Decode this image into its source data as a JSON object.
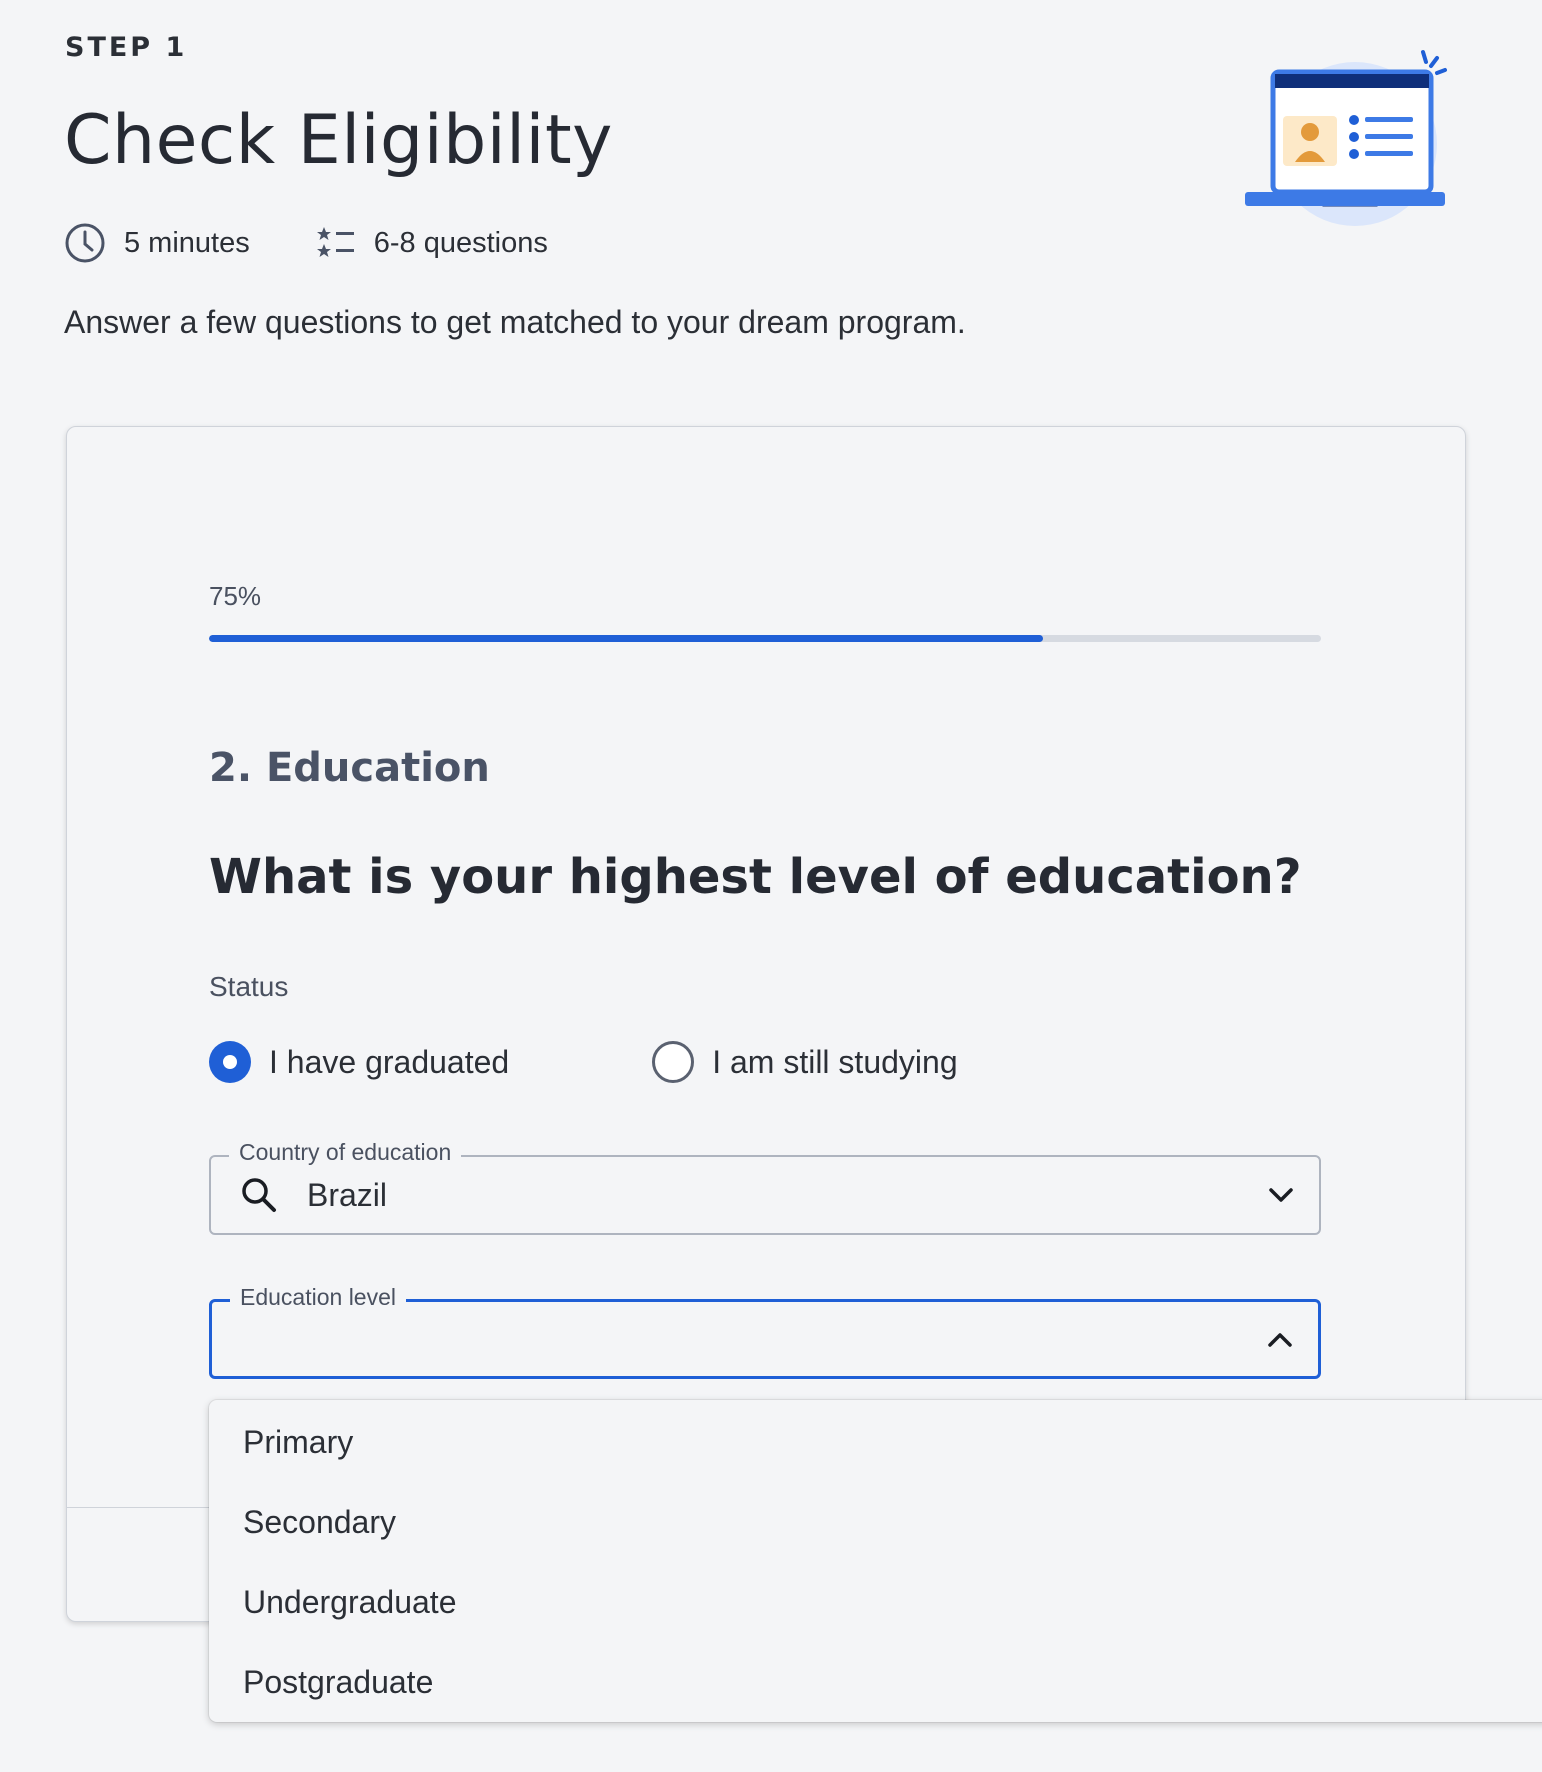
{
  "header": {
    "step": "STEP 1",
    "title": "Check Eligibility",
    "duration": "5 minutes",
    "questions": "6-8 questions",
    "intro": "Answer a few questions to get matched to your dream program."
  },
  "illustration": {
    "icon": "laptop-profile-checklist-icon"
  },
  "progress": {
    "label": "75%",
    "value": 0.75
  },
  "form": {
    "section_title": "2. Education",
    "question": "What is your highest level of education?",
    "status_label": "Status",
    "status_options": [
      {
        "label": "I have graduated",
        "selected": true
      },
      {
        "label": "I am still studying",
        "selected": false
      }
    ],
    "country": {
      "legend": "Country of education",
      "value": "Brazil",
      "icon": "search-icon"
    },
    "education_level": {
      "legend": "Education level",
      "value": "",
      "expanded": true,
      "options": [
        "Primary",
        "Secondary",
        "Undergraduate",
        "Postgraduate"
      ]
    }
  },
  "colors": {
    "accent": "#1f5fd6",
    "background": "#f4f5f7",
    "text": "#2b2f36",
    "track": "#d6dae1"
  }
}
